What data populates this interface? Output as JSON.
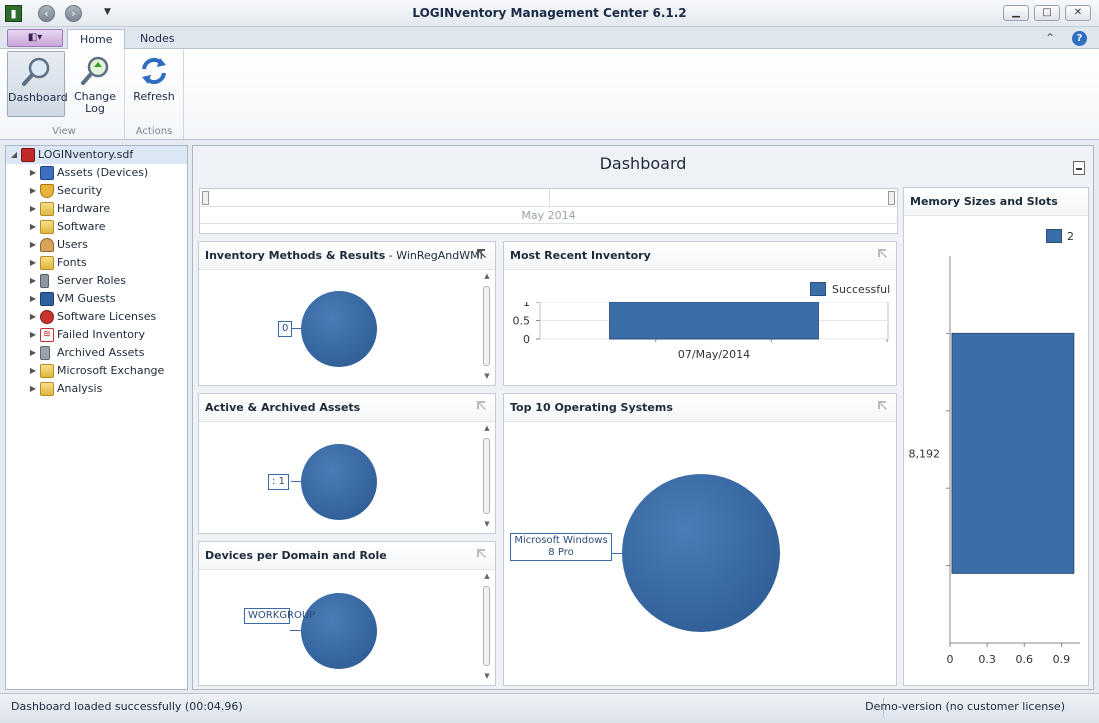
{
  "window": {
    "title": "LOGINventory Management Center 6.1.2",
    "back_icon": "back-arrow-icon",
    "forward_icon": "forward-arrow-icon",
    "minimize_label": "▁",
    "maximize_label": "□",
    "close_label": "✕"
  },
  "ribbon": {
    "app_menu_label": "◧▾",
    "tabs": [
      {
        "label": "Home",
        "active": true
      },
      {
        "label": "Nodes",
        "active": false
      }
    ],
    "help_label": "?",
    "groups": [
      {
        "label": "View",
        "buttons": [
          {
            "label": "Dashboard",
            "icon": "magnifier-icon",
            "pressed": true
          },
          {
            "label": "Change Log",
            "icon": "magnifier-arrow-icon",
            "pressed": false
          }
        ]
      },
      {
        "label": "Actions",
        "buttons": [
          {
            "label": "Refresh",
            "icon": "refresh-icon",
            "pressed": false
          }
        ]
      }
    ]
  },
  "tree": {
    "root": "LOGINventory.sdf",
    "items": [
      {
        "label": "Assets (Devices)",
        "icon": "devices-icon"
      },
      {
        "label": "Security",
        "icon": "shield-icon"
      },
      {
        "label": "Hardware",
        "icon": "folder-icon"
      },
      {
        "label": "Software",
        "icon": "folder-icon"
      },
      {
        "label": "Users",
        "icon": "users-icon"
      },
      {
        "label": "Fonts",
        "icon": "folder-icon"
      },
      {
        "label": "Server Roles",
        "icon": "server-icon"
      },
      {
        "label": "VM Guests",
        "icon": "monitor-icon"
      },
      {
        "label": "Software Licenses",
        "icon": "license-icon"
      },
      {
        "label": "Failed Inventory",
        "icon": "failed-icon"
      },
      {
        "label": "Archived Assets",
        "icon": "archive-icon"
      },
      {
        "label": "Microsoft Exchange",
        "icon": "folder-icon"
      },
      {
        "label": "Analysis",
        "icon": "folder-icon"
      }
    ]
  },
  "dashboard": {
    "title": "Dashboard",
    "range_label": "May 2014",
    "panels": {
      "inventory_methods": {
        "title": "Inventory Methods & Results",
        "subtitle": " - WinRegAndWMI",
        "callout": "0"
      },
      "most_recent": {
        "title": "Most Recent Inventory",
        "legend": "Successful"
      },
      "active_archived": {
        "title": "Active & Archived Assets",
        "callout": ": 1"
      },
      "top_os": {
        "title": "Top 10 Operating Systems",
        "callout": "Microsoft Windows 8 Pro"
      },
      "domain_role": {
        "title": "Devices per Domain and Role",
        "callout": "WORKGROUP"
      },
      "memory": {
        "title": "Memory Sizes and Slots",
        "legend": "2"
      }
    }
  },
  "chart_data": [
    {
      "type": "bar",
      "title": "Most Recent Inventory",
      "categories": [
        "07/May/2014"
      ],
      "series": [
        {
          "name": "Successful",
          "values": [
            1
          ]
        }
      ],
      "yticks": [
        "0",
        "0.5",
        "1"
      ],
      "ylim": [
        0,
        1
      ],
      "legend": "top-right",
      "grid": true
    },
    {
      "type": "bar",
      "orientation": "horizontal",
      "title": "Memory Sizes and Slots",
      "categories": [
        "8,192"
      ],
      "series": [
        {
          "name": "2",
          "values": [
            1
          ]
        }
      ],
      "xticks": [
        "0",
        "0.3",
        "0.6",
        "0.9"
      ],
      "xlim": [
        0,
        1.05
      ],
      "legend": "top-right",
      "grid": false
    }
  ],
  "status": {
    "left": "Dashboard loaded successfully (00:04.96)",
    "right": "Demo-version (no customer license)"
  },
  "colors": {
    "series_blue": "#3b6ea8",
    "bubble_blue": "#33629b"
  }
}
